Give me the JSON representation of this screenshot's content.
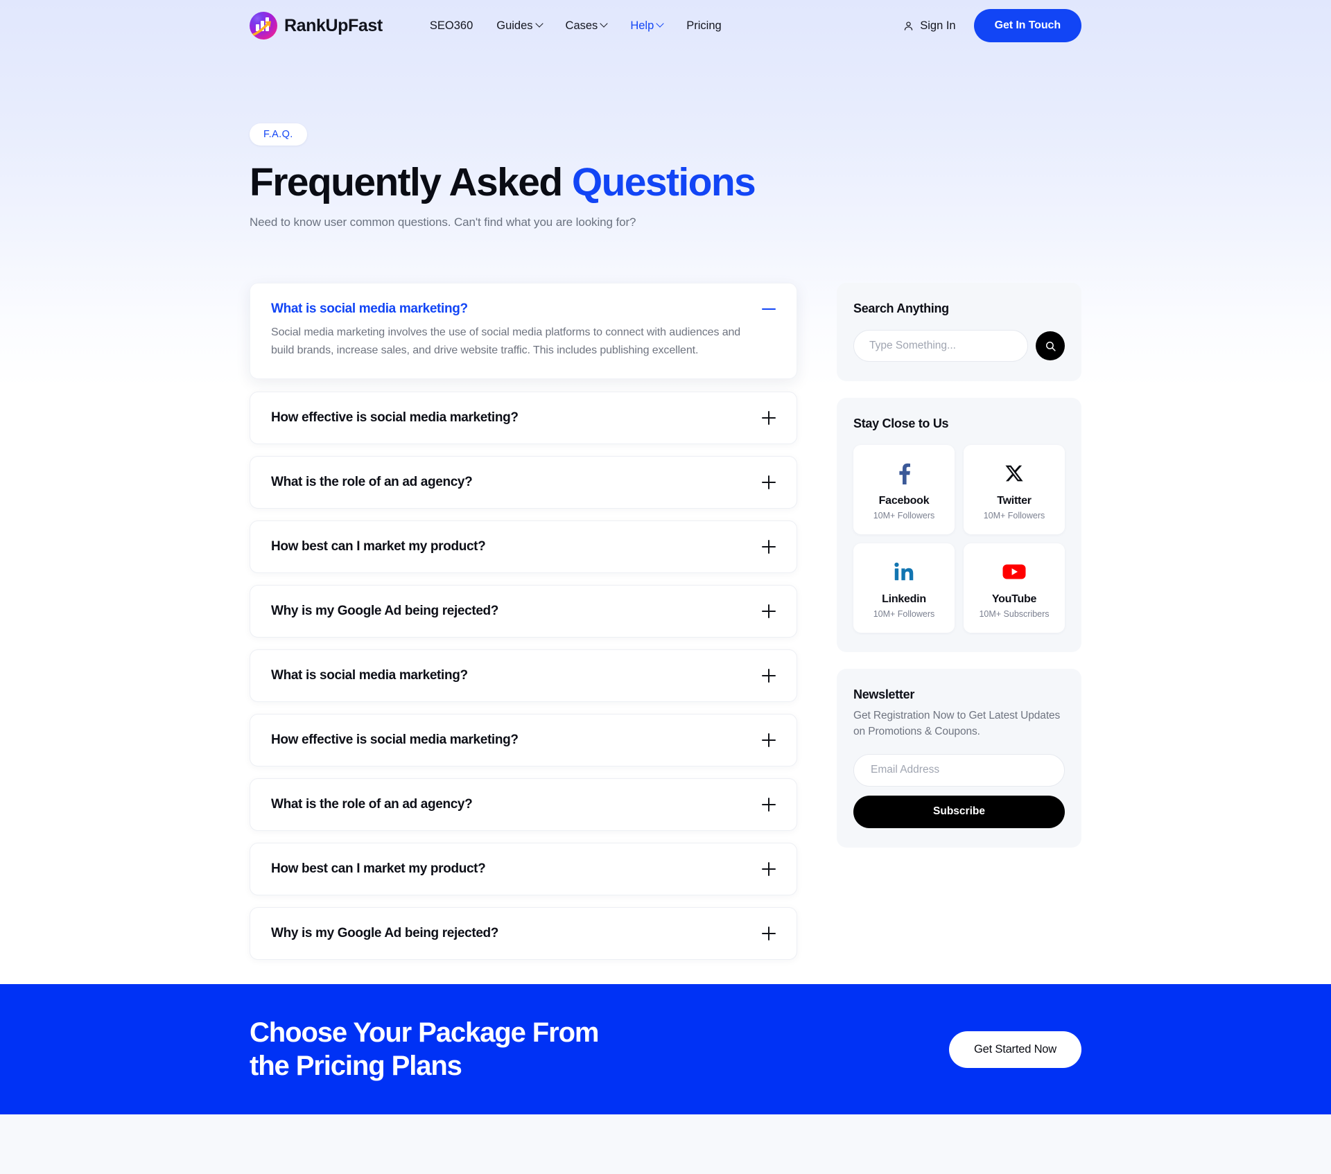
{
  "brand": {
    "name": "RankUpFast",
    "logo_icon": "bar-chart-arrow-logo"
  },
  "nav": {
    "links": [
      {
        "label": "SEO360",
        "has_dropdown": false,
        "active": false
      },
      {
        "label": "Guides",
        "has_dropdown": true,
        "active": false
      },
      {
        "label": "Cases",
        "has_dropdown": true,
        "active": false
      },
      {
        "label": "Help",
        "has_dropdown": true,
        "active": true
      },
      {
        "label": "Pricing",
        "has_dropdown": false,
        "active": false
      }
    ],
    "sign_in": "Sign In",
    "cta": "Get In Touch"
  },
  "hero": {
    "pill": "F.A.Q.",
    "title_plain": "Frequently Asked ",
    "title_accent": "Questions",
    "subtitle": "Need to know user common questions. Can't find what you are looking for?"
  },
  "faq": {
    "items": [
      {
        "question": "What is social media marketing?",
        "answer": "Social media marketing involves the use of social media platforms to connect with audiences and build brands, increase sales, and drive website traffic. This includes publishing excellent.",
        "open": true
      },
      {
        "question": "How effective is social media marketing?",
        "answer": "",
        "open": false
      },
      {
        "question": "What is the role of an ad agency?",
        "answer": "",
        "open": false
      },
      {
        "question": "How best can I market my product?",
        "answer": "",
        "open": false
      },
      {
        "question": "Why is my Google Ad being rejected?",
        "answer": "",
        "open": false
      },
      {
        "question": "What is social media marketing?",
        "answer": "",
        "open": false
      },
      {
        "question": "How effective is social media marketing?",
        "answer": "",
        "open": false
      },
      {
        "question": "What is the role of an ad agency?",
        "answer": "",
        "open": false
      },
      {
        "question": "How best can I market my product?",
        "answer": "",
        "open": false
      },
      {
        "question": "Why is my Google Ad being rejected?",
        "answer": "",
        "open": false
      }
    ]
  },
  "search": {
    "title": "Search Anything",
    "placeholder": "Type Something...",
    "value": "",
    "button_icon": "search-icon"
  },
  "social": {
    "title": "Stay Close to Us",
    "items": [
      {
        "name": "Facebook",
        "stat": "10M+ Followers",
        "icon": "facebook-icon",
        "color": "#3b5998"
      },
      {
        "name": "Twitter",
        "stat": "10M+ Followers",
        "icon": "x-twitter-icon",
        "color": "#000000"
      },
      {
        "name": "Linkedin",
        "stat": "10M+ Followers",
        "icon": "linkedin-icon",
        "color": "#1275b1"
      },
      {
        "name": "YouTube",
        "stat": "10M+ Subscribers",
        "icon": "youtube-icon",
        "color": "#ff0000"
      }
    ]
  },
  "newsletter": {
    "title": "Newsletter",
    "description": "Get Registration Now to Get Latest Updates on Promotions & Coupons.",
    "placeholder": "Email Address",
    "value": "",
    "button": "Subscribe"
  },
  "cta_band": {
    "line1": "Choose Your Package From",
    "line2": "the Pricing Plans",
    "button": "Get Started Now",
    "bg_color": "#0032f5"
  },
  "theme": {
    "accent": "#1245f5",
    "accent_deep": "#0032f5",
    "text": "#0d0f17",
    "muted": "#6f7480"
  }
}
